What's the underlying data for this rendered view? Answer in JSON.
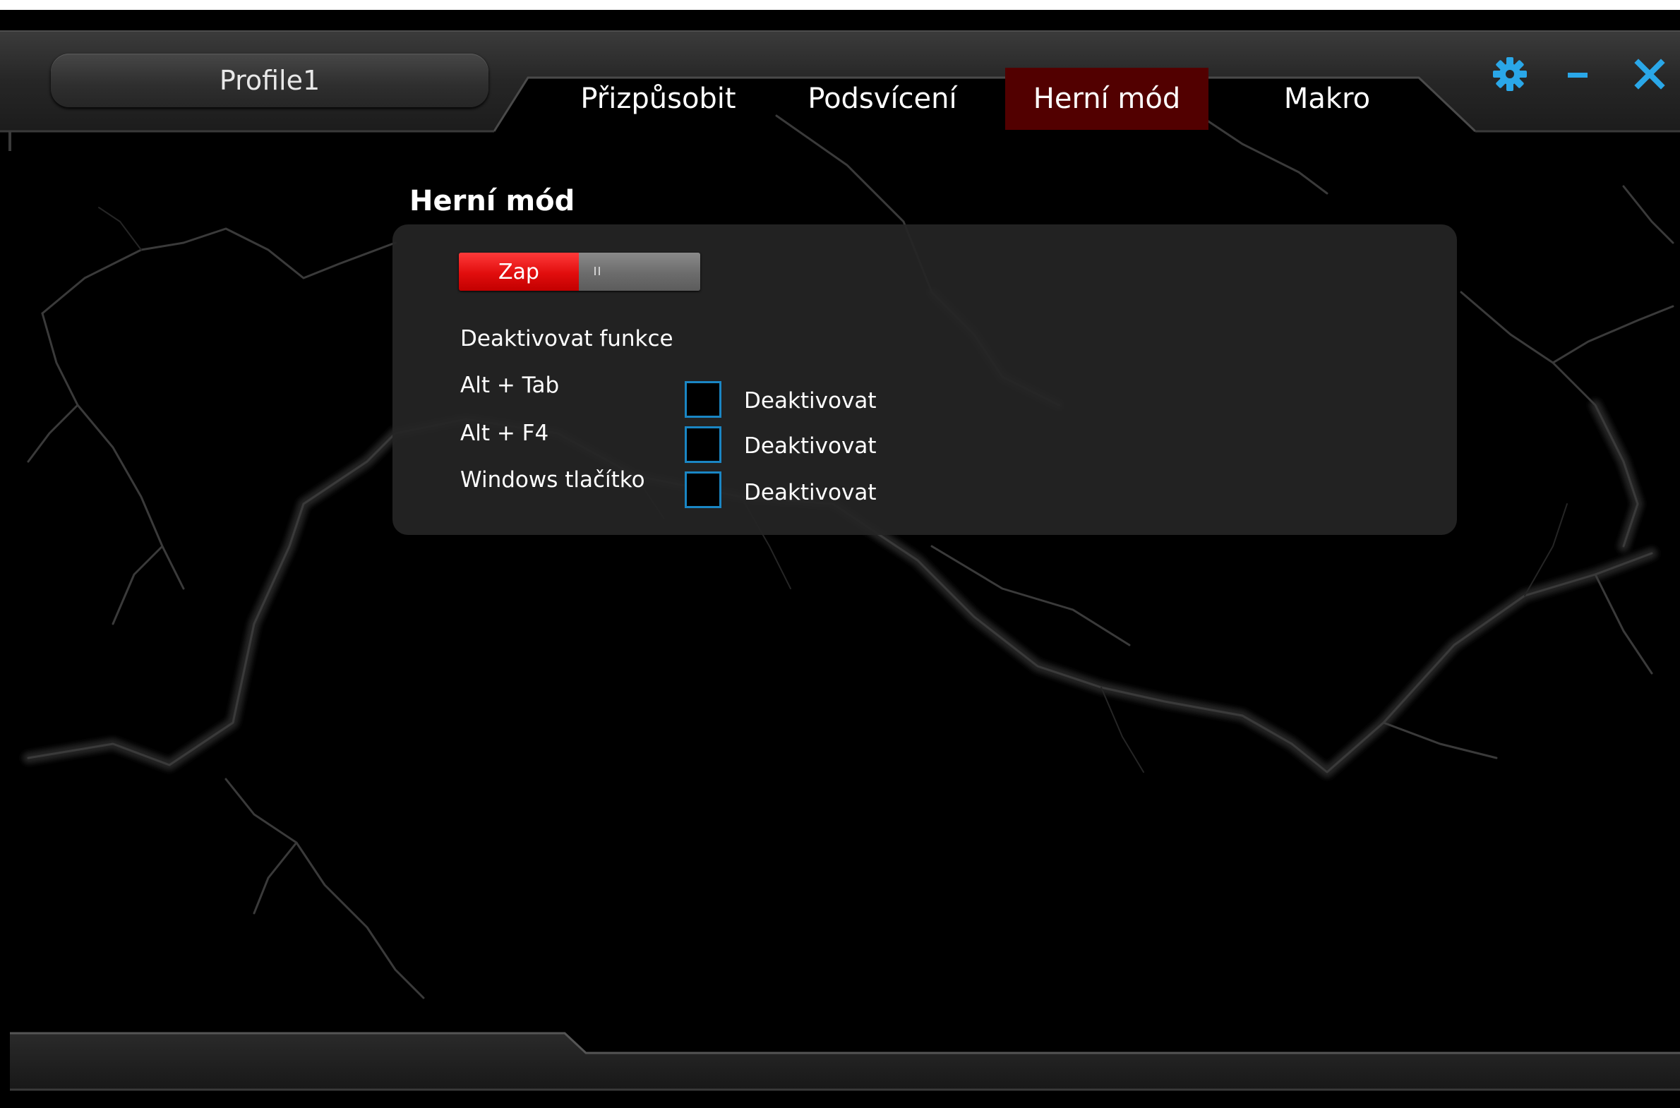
{
  "profile": {
    "name": "Profile1"
  },
  "tabs": [
    {
      "label": "Přizpůsobit",
      "active": false
    },
    {
      "label": "Podsvícení",
      "active": false
    },
    {
      "label": "Herní mód",
      "active": true
    },
    {
      "label": "Makro",
      "active": false
    }
  ],
  "window_controls": {
    "settings_icon": "gear-icon",
    "minimize_icon": "minimize-icon",
    "close_icon": "close-icon",
    "icon_color": "#2aa7e8"
  },
  "game_mode": {
    "title": "Herní mód",
    "toggle": {
      "on_label": "Zap",
      "state": "on",
      "on_color": "#e10d0d"
    },
    "disable_heading": "Deaktivovat funkce",
    "options": [
      {
        "label": "Alt + Tab",
        "checkbox_label": "Deaktivovat",
        "checked": false
      },
      {
        "label": "Alt + F4",
        "checkbox_label": "Deaktivovat",
        "checked": false
      },
      {
        "label": "Windows tlačítko",
        "checkbox_label": "Deaktivovat",
        "checked": false
      }
    ],
    "checkbox_border_color": "#1a86c4"
  },
  "theme": {
    "background": "#000000",
    "panel": "#252525",
    "active_tab": "#520000"
  }
}
